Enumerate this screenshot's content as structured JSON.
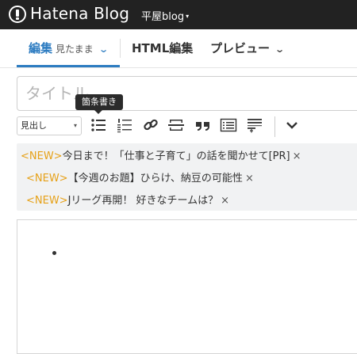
{
  "header": {
    "logo_text": "Hatena Blog",
    "blog_name": "平屋blog",
    "blog_caret": "▾"
  },
  "tabs": [
    {
      "label": "編集",
      "sub": "見たまま",
      "chevron": "⌄",
      "active": true
    },
    {
      "label": "HTML編集",
      "active": false
    },
    {
      "label": "プレビュー",
      "chevron": "⌄",
      "active": false
    }
  ],
  "title_input": {
    "placeholder": "タイトル",
    "value": ""
  },
  "toolbar": {
    "heading_select": "見出し",
    "heading_arrow": "▾",
    "buttons": [
      "bulleted-list",
      "numbered-list",
      "link",
      "horizontal-rule",
      "blockquote",
      "table-of-contents",
      "more-insert",
      "more-dropdown"
    ]
  },
  "tooltip": {
    "text": "箇条書き"
  },
  "notices": [
    {
      "tag": "<NEW>",
      "text": "今日まで！「仕事と子育て」の話を聞かせて[PR]",
      "close": "×"
    },
    {
      "tag": "<NEW>",
      "text": "【今週のお題】ひらけ、納豆の可能性",
      "close": "×"
    },
    {
      "tag": "<NEW>",
      "text": "Jリーグ再開！ 好きなチームは？",
      "close": "×"
    }
  ],
  "colors": {
    "header_bg": "#222222",
    "accent": "#2d7cc1",
    "new_tag": "#e6a118",
    "notice_bg": "#f1f2f3"
  }
}
